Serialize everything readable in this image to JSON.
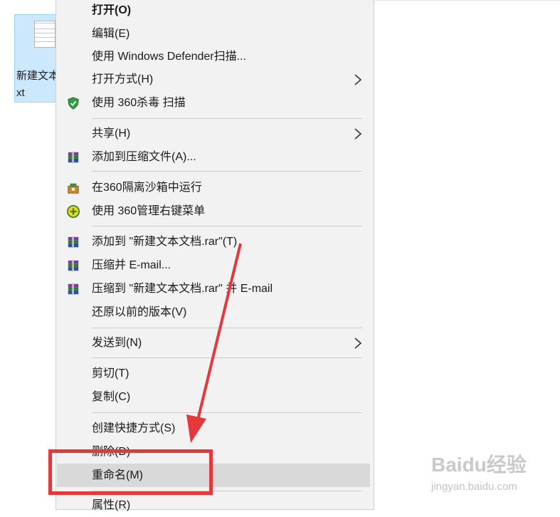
{
  "desktop_file": {
    "label": "新建文本文档.txt"
  },
  "context_menu": {
    "open": "打开(O)",
    "edit": "编辑(E)",
    "defender_scan": "使用 Windows Defender扫描...",
    "open_with": "打开方式(H)",
    "scan_360": "使用 360杀毒 扫描",
    "share": "共享(H)",
    "add_to_archive": "添加到压缩文件(A)...",
    "run_in_sandbox": "在360隔离沙箱中运行",
    "manage_360": "使用 360管理右键菜单",
    "add_to_rar": "添加到 \"新建文本文档.rar\"(T)",
    "compress_email": "压缩并 E-mail...",
    "compress_rar_email": "压缩到 \"新建文本文档.rar\" 并 E-mail",
    "restore_versions": "还原以前的版本(V)",
    "send_to": "发送到(N)",
    "cut": "剪切(T)",
    "copy": "复制(C)",
    "create_shortcut": "创建快捷方式(S)",
    "delete": "删除(D)",
    "rename": "重命名(M)",
    "properties": "属性(R)"
  },
  "watermark": {
    "brand": "Baidu经验",
    "url": "jingyan.baidu.com"
  },
  "colors": {
    "menu_bg": "#f2f2f2",
    "hover_bg": "#d9d9d9",
    "callout": "#e5383b",
    "selection": "#cce8ff"
  }
}
